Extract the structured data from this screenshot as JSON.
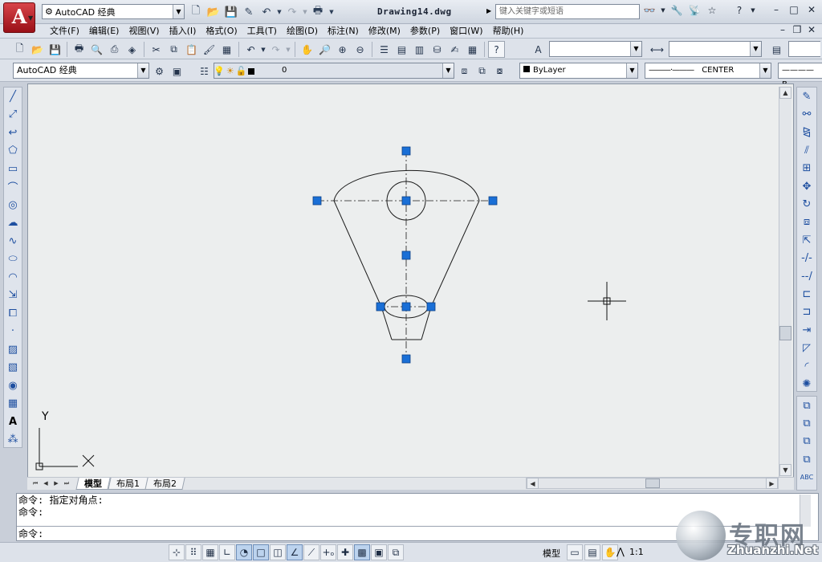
{
  "titlebar": {
    "workspace": "AutoCAD 经典",
    "document_title": "Drawing14.dwg",
    "search_placeholder": "键入关键字或短语",
    "logo_letter": "A"
  },
  "menu": {
    "items": [
      {
        "label": "文件(F)"
      },
      {
        "label": "编辑(E)"
      },
      {
        "label": "视图(V)"
      },
      {
        "label": "插入(I)"
      },
      {
        "label": "格式(O)"
      },
      {
        "label": "工具(T)"
      },
      {
        "label": "绘图(D)"
      },
      {
        "label": "标注(N)"
      },
      {
        "label": "修改(M)"
      },
      {
        "label": "参数(P)"
      },
      {
        "label": "窗口(W)"
      },
      {
        "label": "帮助(H)"
      }
    ]
  },
  "toolbar2": {
    "workspace_combo": "AutoCAD 经典",
    "layer_combo": "0",
    "color_combo": "ByLayer",
    "linetype_combo": "CENTER"
  },
  "layout_tabs": [
    {
      "label": "模型",
      "active": true
    },
    {
      "label": "布局1",
      "active": false
    },
    {
      "label": "布局2",
      "active": false
    }
  ],
  "command": {
    "line1": "命令: 指定对角点:",
    "line2": "命令:",
    "prompt": "命令:"
  },
  "statusbar": {
    "model_label": "模型",
    "anno_scale": "1:1"
  },
  "ucs": {
    "y_label": "Y",
    "x_label": "X"
  },
  "watermark": {
    "text": "专职网",
    "url": "Zhuanzhi.Net"
  },
  "colors": {
    "grip": "#1a6fd6",
    "canvas": "#eceeee",
    "logo_red": "#c0242c"
  },
  "icons": {
    "left_palette": [
      "line-icon",
      "construction-line-icon",
      "polyline-icon",
      "polygon-icon",
      "rectangle-icon",
      "arc-icon",
      "circle-icon",
      "revision-cloud-icon",
      "spline-icon",
      "ellipse-icon",
      "ellipse-arc-icon",
      "insert-block-icon",
      "make-block-icon",
      "point-icon",
      "hatch-icon",
      "gradient-icon",
      "region-icon",
      "table-icon",
      "mtext-icon",
      "add-selected-icon"
    ],
    "right_palette": [
      "erase-icon",
      "copy-icon",
      "mirror-icon",
      "offset-icon",
      "array-icon",
      "move-icon",
      "rotate-icon",
      "scale-icon",
      "stretch-icon",
      "trim-icon",
      "extend-icon",
      "break-at-point-icon",
      "break-icon",
      "join-icon",
      "chamfer-icon",
      "fillet-icon",
      "explode-icon"
    ]
  }
}
